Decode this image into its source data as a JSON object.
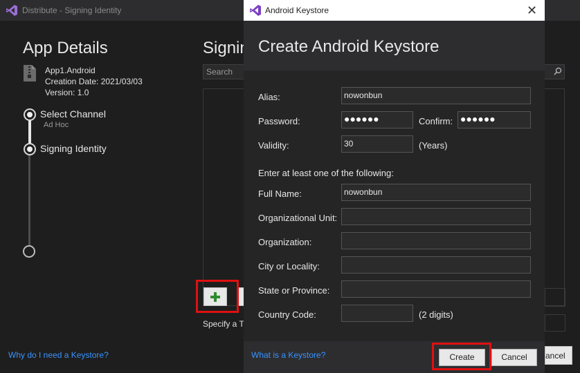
{
  "background_window": {
    "title": "Distribute - Signing Identity",
    "app_details_heading": "App Details",
    "app": {
      "name": "App1.Android",
      "creation_date": "Creation Date: 2021/03/03",
      "version": "Version: 1.0"
    },
    "steps": [
      {
        "label": "Select Channel",
        "sub": "Ad Hoc"
      },
      {
        "label": "Signing Identity"
      }
    ],
    "why_link": "Why do I need a Keystore?",
    "signing_heading": "Signin",
    "search_placeholder": "Search",
    "specify_text": "Specify a Ti",
    "cancel_partial": "ancel"
  },
  "dialog": {
    "title": "Android Keystore",
    "heading": "Create Android Keystore",
    "fields": {
      "alias_label": "Alias:",
      "alias_value": "nowonbun",
      "password_label": "Password:",
      "password_mask": "●●●●●●",
      "confirm_label": "Confirm:",
      "confirm_mask": "●●●●●●",
      "validity_label": "Validity:",
      "validity_value": "30",
      "validity_unit": "(Years)",
      "instruction": "Enter at least one of the following:",
      "full_name_label": "Full Name:",
      "full_name_value": "nowonbun",
      "org_unit_label": "Organizational Unit:",
      "org_label": "Organization:",
      "city_label": "City or Locality:",
      "state_label": "State or Province:",
      "country_label": "Country Code:",
      "country_hint": "(2 digits)"
    },
    "what_link": "What is a Keystore?",
    "create_label": "Create",
    "cancel_label": "Cancel"
  },
  "colors": {
    "accent_link": "#3794ff",
    "highlight": "#e01010",
    "plus_green": "#2e8b2e"
  }
}
